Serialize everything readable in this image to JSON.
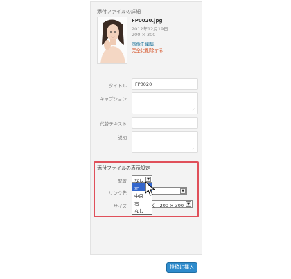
{
  "details": {
    "section_title": "添付ファイルの詳細",
    "file_name": "FP0020.jpg",
    "date": "2012年12月19日",
    "dimensions": "200 × 300",
    "edit_link": "画像を編集",
    "delete_link": "完全に削除する"
  },
  "fields": {
    "title_label": "タイトル",
    "title_value": "FP0020",
    "caption_label": "キャプション",
    "caption_value": "",
    "alt_label": "代替テキスト",
    "alt_value": "",
    "description_label": "説明",
    "description_value": ""
  },
  "display": {
    "section_title": "添付ファイルの表示設定",
    "align_label": "配置",
    "align_value": "なし",
    "link_label": "リンク先",
    "link_value": "",
    "size_label": "サイズ",
    "size_value": "ズ – 200 × 300",
    "align_options": [
      "左",
      "中央",
      "右",
      "なし"
    ],
    "align_highlighted": "左"
  },
  "insert_button": "投稿に挿入",
  "colors": {
    "accent": "#2e8bcc",
    "highlight_box": "#e0505a",
    "delete_link": "#d54e21",
    "edit_link": "#21759b"
  }
}
